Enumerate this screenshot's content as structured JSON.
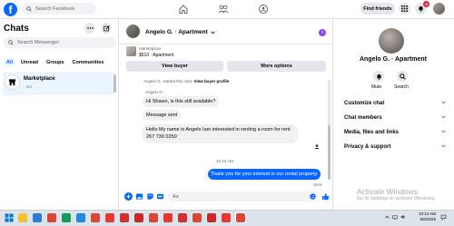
{
  "topbar": {
    "logo": "f",
    "search_placeholder": "Search Facebook",
    "find_friends": "Find friends",
    "notification_count": "4"
  },
  "chats": {
    "title": "Chats",
    "search_placeholder": "Search Messenger",
    "filters": [
      "All",
      "Unread",
      "Groups",
      "Communities"
    ],
    "active_filter": "All",
    "conversations": [
      {
        "name": "Marketplace",
        "time": "· 1m"
      }
    ]
  },
  "conversation": {
    "title": "Angelo G. · Apartment",
    "listing": {
      "label": "Marketplace",
      "price": "$510 · Apartment"
    },
    "view_buyer": "View buyer",
    "more_options": "More options",
    "system_message_prefix": "Angelo G. started this chat.",
    "system_message_link": "View buyer profile",
    "sender_label": "Angelo G.",
    "incoming": [
      "Hi Shawn, is this still available?",
      "Message sent",
      "Hello My name is Angelo Iam interested in renting a room for rent 267 730 0250"
    ],
    "timestamp": "10:13 AM",
    "outgoing": "Thank you for your interest in our rental property.",
    "status": "Sent",
    "composer_placeholder": "Aa"
  },
  "profile": {
    "name": "Angelo G. · Apartment",
    "actions": [
      "Mute",
      "Search"
    ],
    "sections": [
      "Customize chat",
      "Chat members",
      "Media, files and links",
      "Privacy & support"
    ]
  },
  "os": {
    "watermark_title": "Activate Windows",
    "watermark_subtitle": "Go to Settings to activate Windows.",
    "time": "10:14 AM",
    "date": "5/8/2025"
  },
  "colors": {
    "brand_blue": "#0866ff",
    "info_purple": "#8a3ffc",
    "badge_red": "#e41e3f"
  }
}
